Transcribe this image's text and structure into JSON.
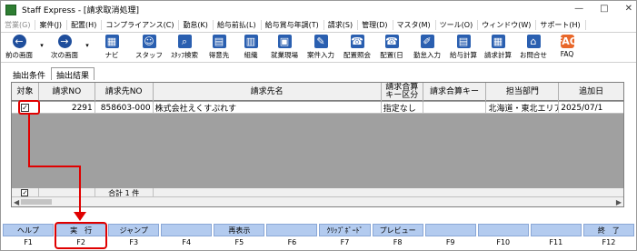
{
  "window": {
    "title": "Staff Express - [請求取消処理]",
    "controls": [
      "—",
      "□",
      "✕"
    ]
  },
  "menu": [
    {
      "label": "営業(G)",
      "disabled": true
    },
    {
      "label": "案件(J)"
    },
    {
      "label": "配置(H)"
    },
    {
      "label": "コンプライアンス(C)"
    },
    {
      "label": "勤怠(K)"
    },
    {
      "label": "給与前払(L)"
    },
    {
      "label": "給与賞与年調(T)"
    },
    {
      "label": "請求(S)"
    },
    {
      "label": "管理(D)"
    },
    {
      "label": "マスタ(M)"
    },
    {
      "label": "ツール(O)"
    },
    {
      "label": "ウィンドウ(W)"
    },
    {
      "label": "サポート(H)"
    }
  ],
  "toolbar": [
    {
      "label": "前の画面",
      "icon": "back-arrow-icon"
    },
    {
      "label": "次の画面",
      "icon": "forward-arrow-icon"
    },
    {
      "label": "ナビ",
      "icon": "navi-icon"
    },
    {
      "label": "スタッフ",
      "icon": "staff-icon"
    },
    {
      "label": "ｽﾀｯﾌ検索",
      "icon": "staff-search-icon"
    },
    {
      "label": "得意先",
      "icon": "customer-icon"
    },
    {
      "label": "組織",
      "icon": "organization-icon"
    },
    {
      "label": "就業現場",
      "icon": "worksite-icon"
    },
    {
      "label": "案件入力",
      "icon": "case-entry-icon"
    },
    {
      "label": "配置照会",
      "icon": "assignment-inquiry-icon"
    },
    {
      "label": "配置(日",
      "icon": "assignment-daily-icon"
    },
    {
      "label": "勤怠入力",
      "icon": "attendance-entry-icon"
    },
    {
      "label": "給与計算",
      "icon": "payroll-icon"
    },
    {
      "label": "請求計算",
      "icon": "billing-calc-icon"
    },
    {
      "label": "お問合せ",
      "icon": "inquiry-icon"
    },
    {
      "label": "FAQ",
      "icon": "faq-icon"
    }
  ],
  "tabs": [
    {
      "label": "抽出条件",
      "active": false
    },
    {
      "label": "抽出結果",
      "active": true
    }
  ],
  "grid": {
    "headers": [
      "対象",
      "請求NO",
      "請求先NO",
      "請求先名",
      "請求合算キー区分",
      "請求合算キー",
      "担当部門",
      "追加日"
    ],
    "rows": [
      {
        "checked": true,
        "cells": [
          "",
          "2291",
          "858603-000",
          "株式会社えくすぷれす",
          "指定なし",
          "",
          "北海道・東北エリア",
          "2025/07/1"
        ]
      }
    ],
    "footer": {
      "checked": true,
      "total_label": "合計",
      "total_value": "1 件"
    }
  },
  "function_keys": [
    {
      "label": "ヘルプ",
      "key": "F1"
    },
    {
      "label": "実　行",
      "key": "F2"
    },
    {
      "label": "ジャンプ",
      "key": "F3"
    },
    {
      "label": "",
      "key": "F4"
    },
    {
      "label": "再表示",
      "key": "F5"
    },
    {
      "label": "",
      "key": "F6"
    },
    {
      "label": "ｸﾘｯﾌﾟﾎﾞｰﾄﾞ",
      "key": "F7"
    },
    {
      "label": "プレビュー",
      "key": "F8"
    },
    {
      "label": "",
      "key": "F9"
    },
    {
      "label": "",
      "key": "F10"
    },
    {
      "label": "",
      "key": "F11"
    },
    {
      "label": "終　了",
      "key": "F12"
    }
  ]
}
